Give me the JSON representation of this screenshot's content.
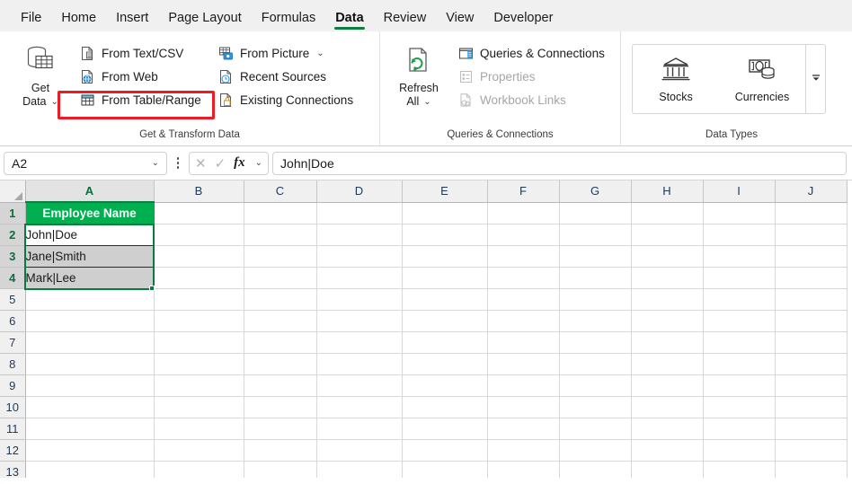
{
  "ribbon": {
    "tabs": [
      {
        "label": "File",
        "active": false
      },
      {
        "label": "Home",
        "active": false
      },
      {
        "label": "Insert",
        "active": false
      },
      {
        "label": "Page Layout",
        "active": false
      },
      {
        "label": "Formulas",
        "active": false
      },
      {
        "label": "Data",
        "active": true
      },
      {
        "label": "Review",
        "active": false
      },
      {
        "label": "View",
        "active": false
      },
      {
        "label": "Developer",
        "active": false
      }
    ],
    "groups": {
      "get_transform": {
        "label": "Get & Transform Data",
        "get_data": {
          "line1": "Get",
          "line2": "Data",
          "chevron": "⌄",
          "icon": "database-table-icon"
        },
        "commands": [
          {
            "label": "From Text/CSV",
            "icon": "text-csv-file-icon",
            "disabled": false,
            "chevron": ""
          },
          {
            "label": "From Web",
            "icon": "web-globe-file-icon",
            "disabled": false,
            "chevron": ""
          },
          {
            "label": "From Table/Range",
            "icon": "table-range-icon",
            "disabled": false,
            "chevron": "",
            "highlighted": true
          },
          {
            "label": "From Picture",
            "icon": "picture-camera-icon",
            "disabled": false,
            "chevron": "⌄"
          },
          {
            "label": "Recent Sources",
            "icon": "recent-clock-file-icon",
            "disabled": false,
            "chevron": ""
          },
          {
            "label": "Existing Connections",
            "icon": "existing-connections-icon",
            "disabled": false,
            "chevron": ""
          }
        ]
      },
      "queries": {
        "label": "Queries & Connections",
        "refresh_all": {
          "line1": "Refresh",
          "line2": "All",
          "chevron": "⌄",
          "icon": "refresh-all-icon"
        },
        "commands": [
          {
            "label": "Queries & Connections",
            "icon": "queries-pane-icon",
            "disabled": false
          },
          {
            "label": "Properties",
            "icon": "properties-icon",
            "disabled": true
          },
          {
            "label": "Workbook Links",
            "icon": "workbook-links-icon",
            "disabled": true
          }
        ]
      },
      "data_types": {
        "label": "Data Types",
        "items": [
          {
            "label": "Stocks",
            "icon": "bank-stocks-icon"
          },
          {
            "label": "Currencies",
            "icon": "currency-money-icon"
          }
        ],
        "more_label": "⌄",
        "more_icon": "gallery-more-icon"
      }
    }
  },
  "formula_bar": {
    "name_box_value": "A2",
    "name_box_chevron": "⌄",
    "cancel_icon": "✕",
    "confirm_icon": "✓",
    "fx_label": "fx",
    "fx_chevron": "⌄",
    "formula_value": "John|Doe",
    "kebab_icon": "more-options-icon"
  },
  "grid": {
    "columns": [
      "A",
      "B",
      "C",
      "D",
      "E",
      "F",
      "G",
      "H",
      "I",
      "J"
    ],
    "selected_columns": [
      "A"
    ],
    "rows": [
      "1",
      "2",
      "3",
      "4",
      "5",
      "6",
      "7",
      "8",
      "9",
      "10",
      "11",
      "12",
      "13"
    ],
    "selected_rows": [
      "1",
      "2",
      "3",
      "4"
    ],
    "cells": {
      "A1": "Employee Name",
      "A2": "John|Doe",
      "A3": "Jane|Smith",
      "A4": "Mark|Lee"
    },
    "active_cell": "A2",
    "selection_range": "A2:A4"
  },
  "colors": {
    "table_header_green": "#00B050",
    "selection_green": "#0B7A3E",
    "highlight_red": "#ED1C24",
    "tab_accent": "#107C41"
  }
}
